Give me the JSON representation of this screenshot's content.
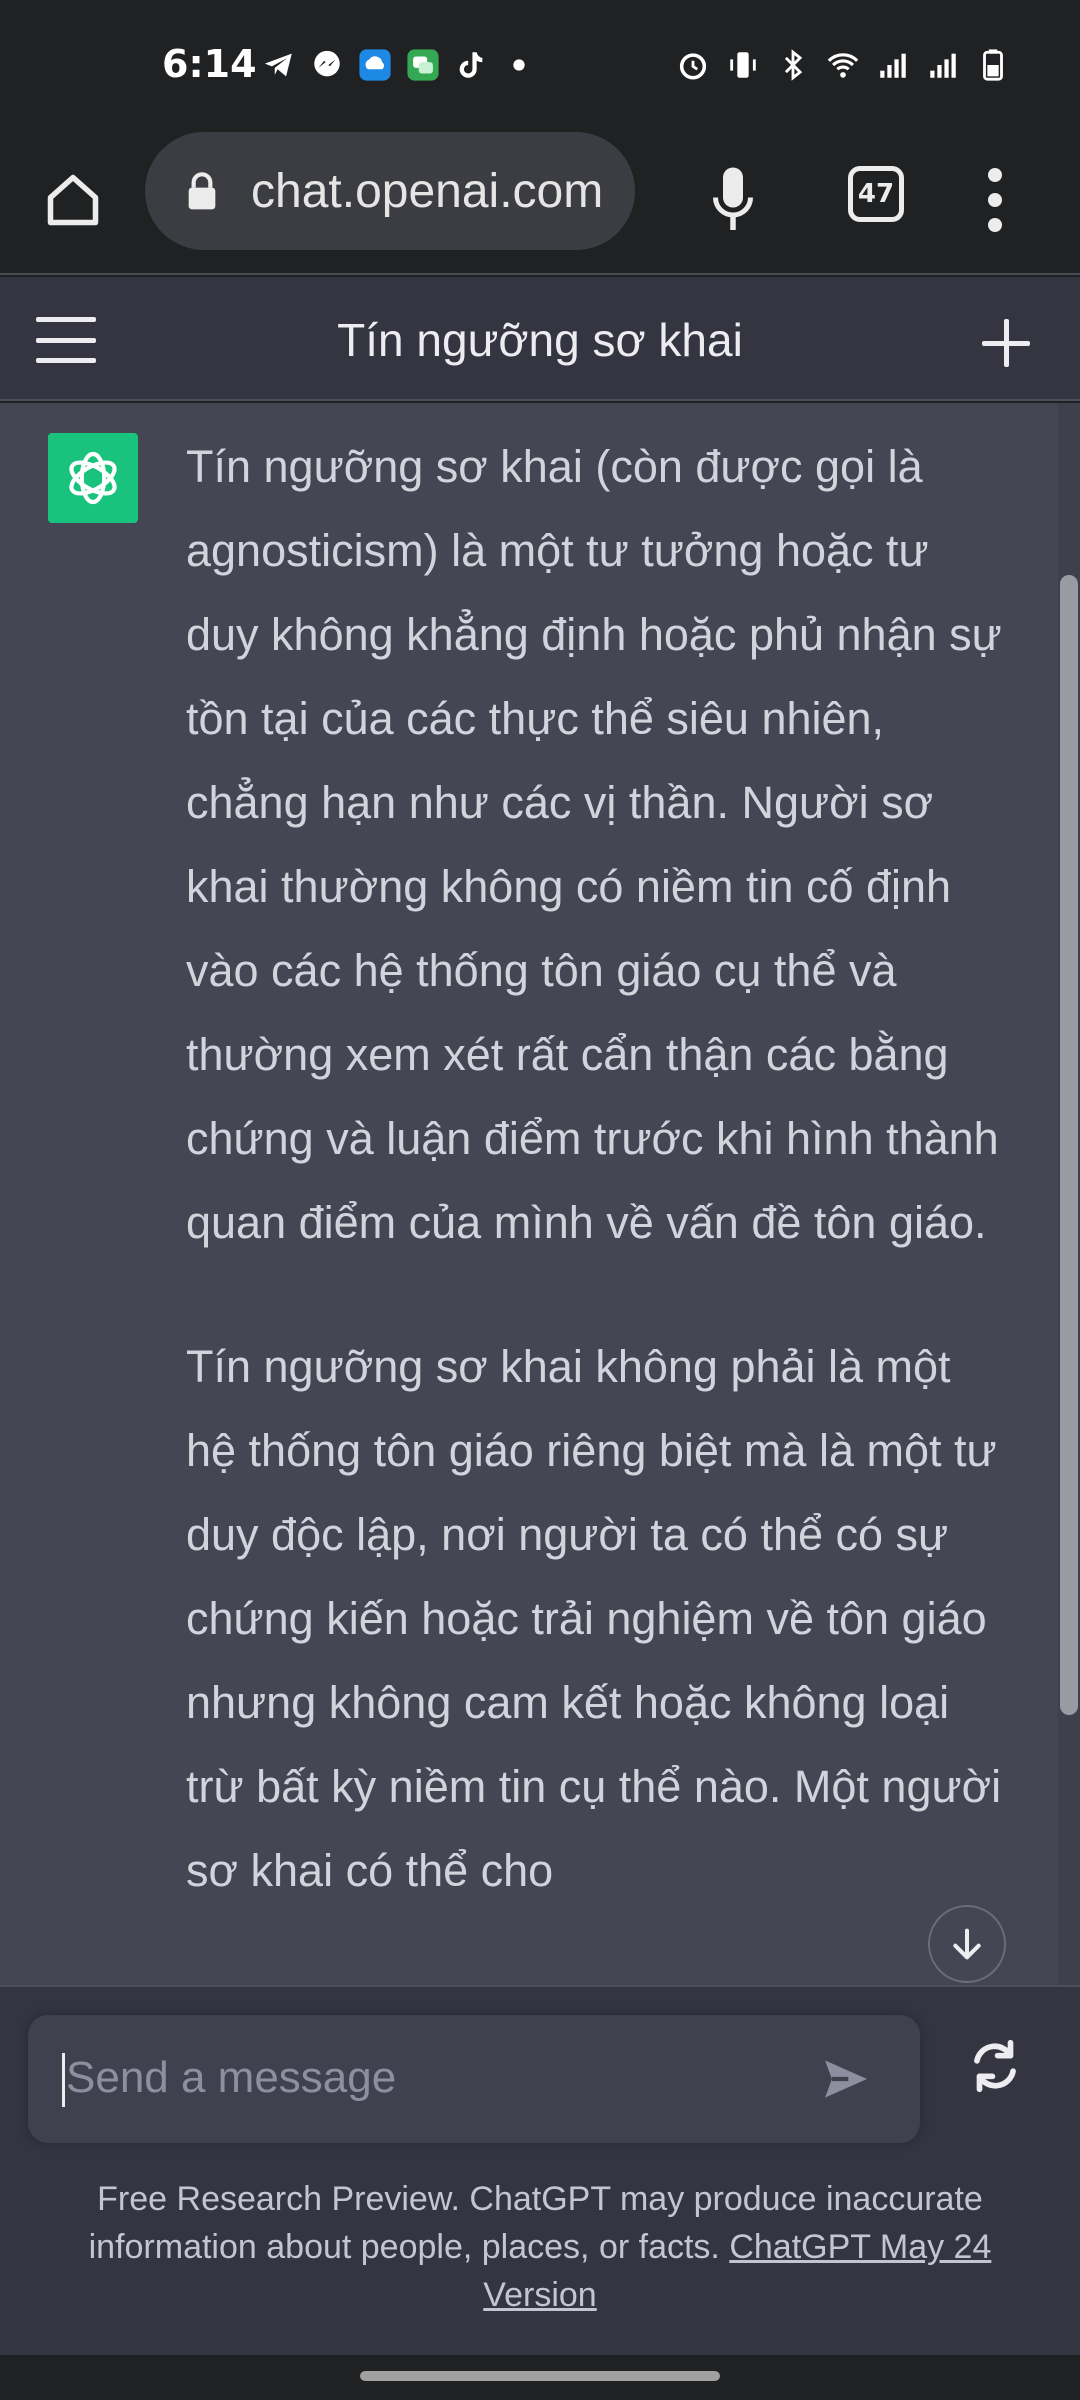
{
  "status_bar": {
    "time": "6:14",
    "left_icons": [
      "telegram-icon",
      "messenger-icon",
      "cloud-upload-icon",
      "messages-icon",
      "tiktok-icon",
      "dot-icon"
    ],
    "right_icons": [
      "alarm-icon",
      "vibrate-icon",
      "bluetooth-icon",
      "wifi-icon",
      "signal-icon",
      "signal-icon",
      "battery-icon"
    ]
  },
  "browser": {
    "url": "chat.openai.com",
    "tab_count": "47"
  },
  "chat": {
    "title": "Tín ngưỡng sơ khai",
    "messages": [
      {
        "role": "assistant",
        "paragraphs": [
          "Tín ngưỡng sơ khai (còn được gọi là agnosticism) là một tư tưởng hoặc tư duy không khẳng định hoặc phủ nhận sự tồn tại của các thực thể siêu nhiên, chẳng hạn như các vị thần. Người sơ khai thường không có niềm tin cố định vào các hệ thống tôn giáo cụ thể và thường xem xét rất cẩn thận các bằng chứng và luận điểm trước khi hình thành quan điểm của mình về vấn đề tôn giáo.",
          "Tín ngưỡng sơ khai không phải là một hệ thống tôn giáo riêng biệt mà là một tư duy độc lập, nơi người ta có thể có sự chứng kiến hoặc trải nghiệm về tôn giáo nhưng không cam kết hoặc không loại trừ bất kỳ niềm tin cụ thể nào. Một người sơ khai có thể cho"
        ]
      }
    ]
  },
  "composer": {
    "placeholder": "Send a message"
  },
  "footer": {
    "disclaimer": "Free Research Preview. ChatGPT may produce inaccurate information about people, places, or facts.",
    "version_link": "ChatGPT May 24 Version"
  },
  "colors": {
    "accent": "#19c37d",
    "background": "#343541",
    "message_bg": "#444654"
  }
}
